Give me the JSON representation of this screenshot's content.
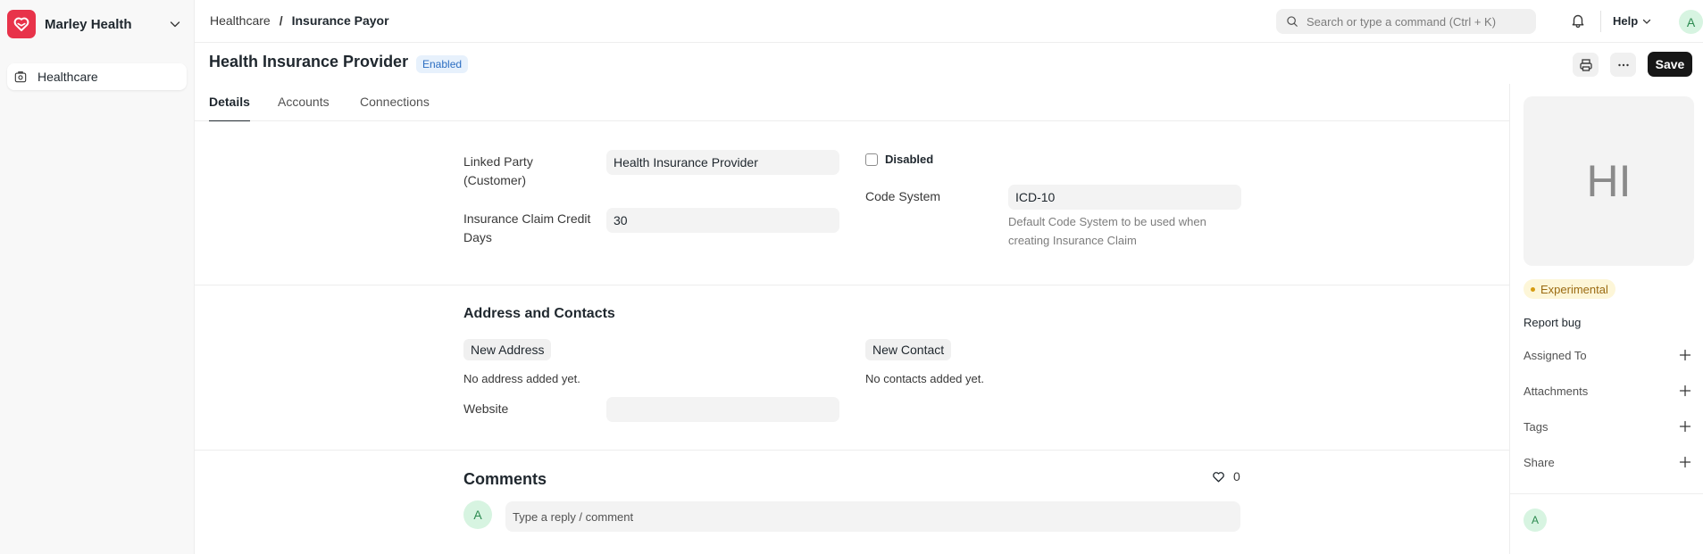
{
  "sidebar": {
    "workspace_name": "Marley Health",
    "items": [
      {
        "label": "Healthcare",
        "icon": "healthcare-icon"
      }
    ]
  },
  "navbar": {
    "breadcrumbs": [
      "Healthcare",
      "Insurance Payor"
    ],
    "breadcrumb_separator": "/",
    "search_placeholder": "Search or type a command (Ctrl + K)",
    "help_label": "Help",
    "avatar_initial": "A"
  },
  "header": {
    "title": "Health Insurance Provider",
    "status": "Enabled",
    "save_label": "Save"
  },
  "tabs": [
    {
      "label": "Details",
      "active": true
    },
    {
      "label": "Accounts",
      "active": false
    },
    {
      "label": "Connections",
      "active": false
    }
  ],
  "form": {
    "linked_party": {
      "label_line1": "Linked Party",
      "label_line2": "(Customer)",
      "value": "Health Insurance Provider"
    },
    "credit_days": {
      "label_line1": "Insurance Claim Credit",
      "label_line2": "Days",
      "value": "30"
    },
    "disabled": {
      "label": "Disabled",
      "checked": false
    },
    "code_system": {
      "label": "Code System",
      "value": "ICD-10",
      "help_line1": "Default Code System to be used when",
      "help_line2": "creating Insurance Claim"
    }
  },
  "address_section": {
    "title": "Address and Contacts",
    "new_address_label": "New Address",
    "no_address_text": "No address added yet.",
    "new_contact_label": "New Contact",
    "no_contact_text": "No contacts added yet.",
    "website_label": "Website",
    "website_value": ""
  },
  "comments": {
    "title": "Comments",
    "likes_count": "0",
    "avatar_initial": "A",
    "placeholder": "Type a reply / comment"
  },
  "right_sidebar": {
    "image_initials": "HI",
    "experimental_label": "Experimental",
    "report_bug_label": "Report bug",
    "rows": [
      {
        "label": "Assigned To"
      },
      {
        "label": "Attachments"
      },
      {
        "label": "Tags"
      },
      {
        "label": "Share"
      }
    ],
    "avatar_initial": "A"
  },
  "colors": {
    "brand": "#e8334a",
    "primary_button": "#171717",
    "enabled_badge_bg": "#e7f1fc",
    "enabled_badge_text": "#2c6ec1",
    "experimental_bg": "#fdf6d8",
    "avatar_bg": "#d7f4e1"
  }
}
